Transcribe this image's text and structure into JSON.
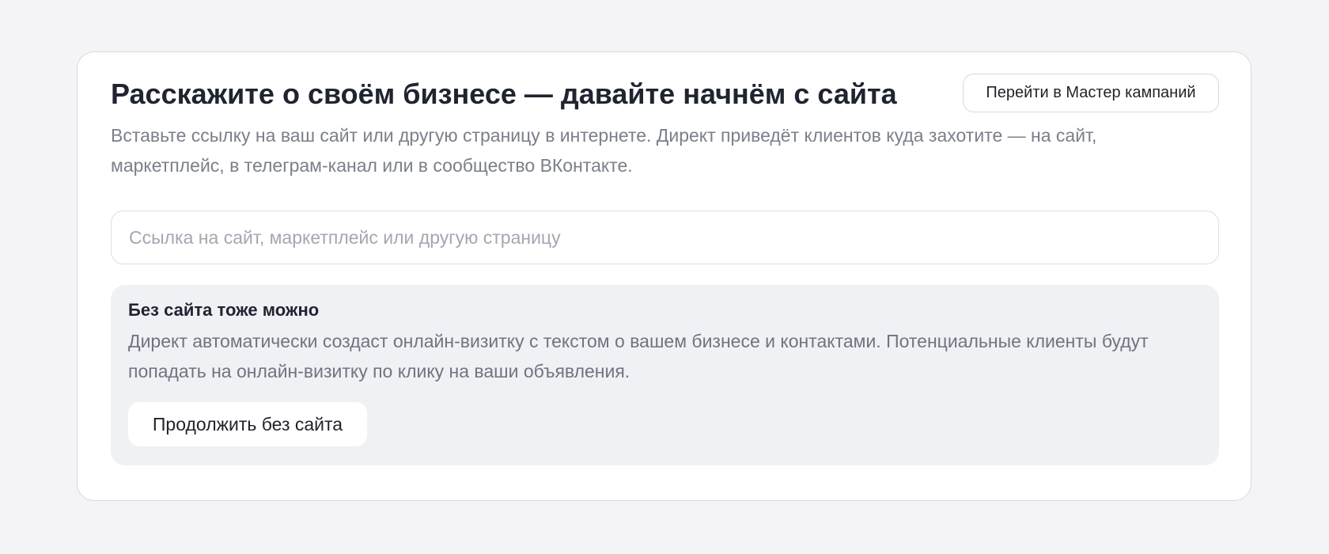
{
  "header": {
    "title": "Расскажите о своём бизнесе — давайте начнём с сайта",
    "master_button_label": "Перейти в Мастер кампаний",
    "subtitle": "Вставьте ссылку на ваш сайт или другую страницу в интернете. Директ приведёт клиентов куда захотите — на сайт, маркетплейс, в телеграм-канал или в сообщество ВКонтакте."
  },
  "url_field": {
    "value": "",
    "placeholder": "Ссылка на сайт, маркетплейс или другую страницу"
  },
  "no_site": {
    "title": "Без сайта тоже можно",
    "text": "Директ автоматически создаст онлайн-визитку с текстом о вашем бизнесе и контактами. Потенциальные клиенты будут попадать на онлайн-визитку по клику на ваши объявления.",
    "button_label": "Продолжить без сайта"
  },
  "colors": {
    "page_background": "#f4f4f6",
    "card_background": "#ffffff",
    "panel_background": "#f0f1f5",
    "title_text": "#1f2430",
    "secondary_text": "#7b7f8b"
  }
}
